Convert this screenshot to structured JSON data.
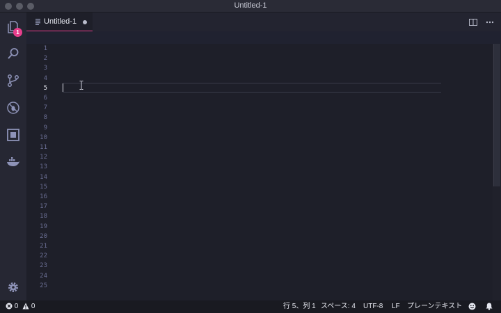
{
  "window": {
    "title": "Untitled-1"
  },
  "activity_bar": {
    "explorer_badge": "1",
    "items": [
      "explorer-icon",
      "search-icon",
      "source-control-icon",
      "debug-icon",
      "extensions-icon",
      "docker-icon"
    ],
    "settings": "gear-icon"
  },
  "tabs": [
    {
      "label": "Untitled-1",
      "dirty": true,
      "active": true
    }
  ],
  "editor_actions": [
    "split-editor-icon",
    "more-actions-icon"
  ],
  "editor": {
    "line_numbers": [
      "1",
      "2",
      "3",
      "4",
      "5",
      "6",
      "7",
      "8",
      "9",
      "10",
      "11",
      "12",
      "13",
      "14",
      "15",
      "16",
      "17",
      "18",
      "19",
      "20",
      "21",
      "22",
      "23",
      "24",
      "25"
    ],
    "active_line": "5"
  },
  "statusbar": {
    "errors": "0",
    "warnings": "0",
    "position": "行 5、列 1",
    "indent": "スペース: 4",
    "encoding": "UTF-8",
    "eol": "LF",
    "language": "プレーンテキスト"
  },
  "colors": {
    "accent": "#e83e8c",
    "editor_bg": "#1e1f29",
    "line_number": "#6a6e93"
  }
}
